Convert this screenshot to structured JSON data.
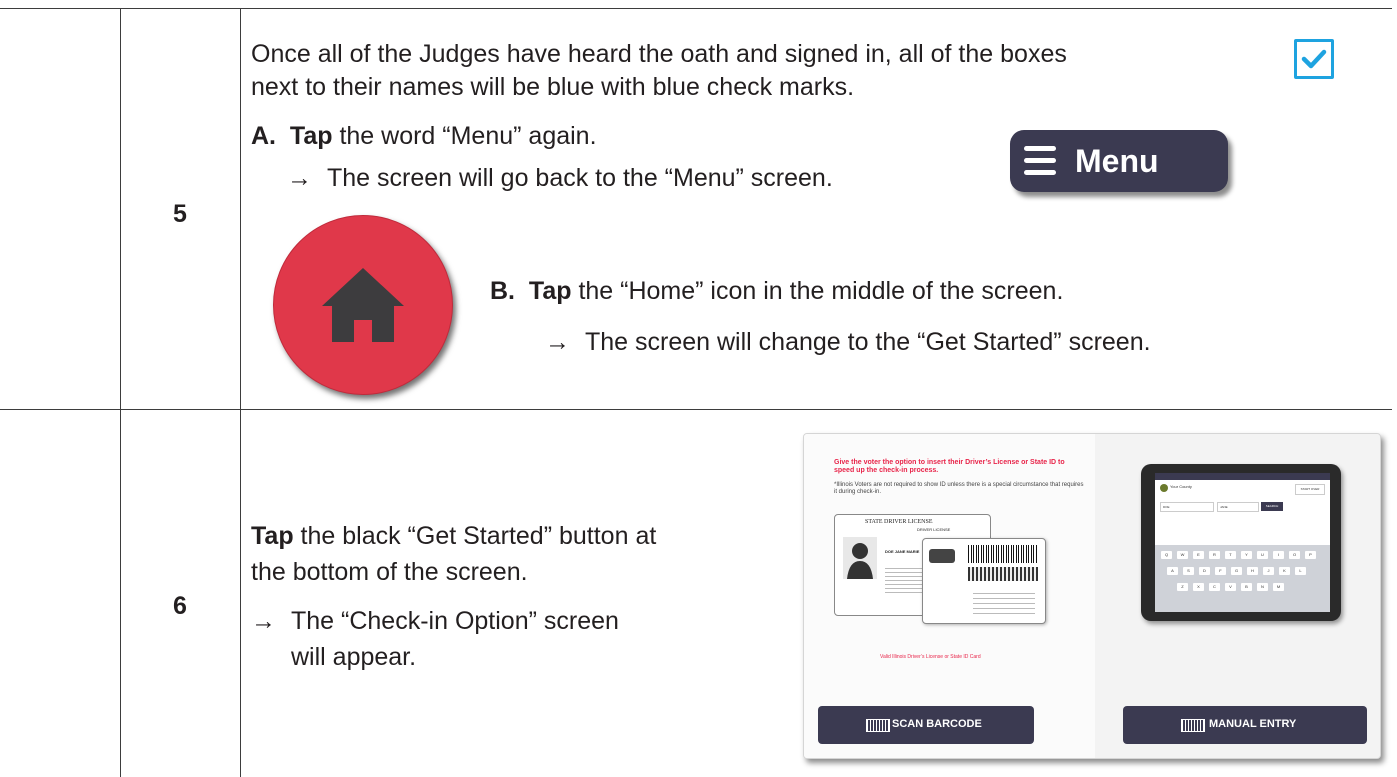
{
  "colors": {
    "accent_blue": "#1ea3e0",
    "menu_dark": "#3b3a51",
    "home_red": "#e0384a",
    "alert_red": "#e8254a"
  },
  "step5": {
    "number": "5",
    "line1": "Once all of the Judges have heard the oath and signed in, all of the boxes",
    "line2": "next to their names will be blue with blue check marks.",
    "a_marker": "A.",
    "a_action": "Tap",
    "a_rest": " the word “Menu” again.",
    "a_arrow": "→",
    "a_result": "The screen will go back to the “Menu” screen.",
    "menu_button_label": "Menu",
    "check_icon": "checkbox-checked-icon",
    "home_icon": "home-icon",
    "b_marker": "B.",
    "b_action": "Tap",
    "b_rest": " the “Home” icon in the middle of the screen.",
    "b_arrow": "→",
    "b_result": "The screen will change to the “Get Started” screen."
  },
  "step6": {
    "number": "6",
    "action": "Tap",
    "rest1": " the black “Get Started” button at",
    "rest2": "the bottom of the screen.",
    "arrow": "→",
    "result1": "The “Check-in Option” screen",
    "result2": "will appear.",
    "screenshot": {
      "headline": "Give the voter the option to insert their Driver’s License or State ID to speed up the check-in process.",
      "note": "*Illinois Voters are not required to show ID unless there is a special circumstance that requires it during check-in.",
      "card_title": "STATE DRIVER LICENSE",
      "card_subtitle": "DRIVER LICENSE",
      "card_name": "DOE JANE MARIE",
      "card_caption": "Valid Illinois Driver’s License or State ID Card",
      "scan_button": "SCAN BARCODE",
      "manual_button": "MANUAL ENTRY",
      "ipad_county": "Your County",
      "ipad_search": "SEARCH",
      "ipad_start": "START OVER",
      "ipad_last": "DOE",
      "ipad_first": "JANE",
      "keys_row1": [
        "Q",
        "W",
        "E",
        "R",
        "T",
        "Y",
        "U",
        "I",
        "O",
        "P"
      ],
      "keys_row2": [
        "A",
        "S",
        "D",
        "F",
        "G",
        "H",
        "J",
        "K",
        "L"
      ],
      "keys_row3": [
        "Z",
        "X",
        "C",
        "V",
        "B",
        "N",
        "M"
      ]
    }
  }
}
